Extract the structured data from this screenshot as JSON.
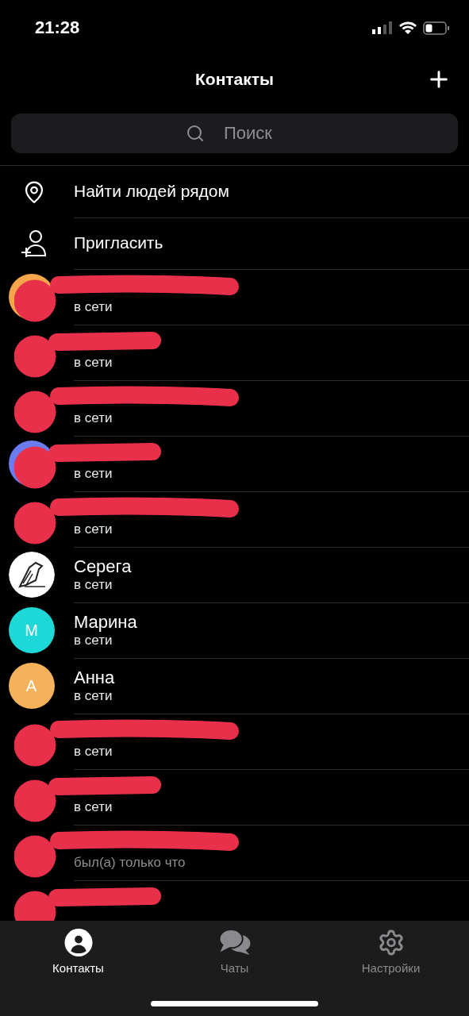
{
  "status_bar": {
    "time": "21:28"
  },
  "header": {
    "title": "Контакты"
  },
  "search": {
    "placeholder": "Поиск"
  },
  "actions": [
    {
      "kind": "nearby",
      "label": "Найти людей рядом"
    },
    {
      "kind": "invite",
      "label": "Пригласить"
    }
  ],
  "contacts": [
    {
      "redacted": true,
      "avatar": {
        "kind": "ring",
        "color": "#f5a54a"
      },
      "status": "в сети",
      "online": true
    },
    {
      "redacted": true,
      "status": "в сети",
      "online": true
    },
    {
      "redacted": true,
      "status": "в сети",
      "online": true
    },
    {
      "redacted": true,
      "avatar": {
        "kind": "ring",
        "color": "#6b7cf0"
      },
      "status": "в сети",
      "online": true
    },
    {
      "redacted": true,
      "status": "в сети",
      "online": true
    },
    {
      "redacted": false,
      "name": "Серега",
      "status": "в сети",
      "online": true
    },
    {
      "redacted": false,
      "name": "Марина",
      "avatar": {
        "kind": "letter",
        "letter": "М",
        "color": "#1ed8d8"
      },
      "status": "в сети",
      "online": true
    },
    {
      "redacted": false,
      "name": "Анна",
      "avatar": {
        "kind": "letter",
        "letter": "А",
        "color": "#f6b25a"
      },
      "status": "в сети",
      "online": true
    },
    {
      "redacted": true,
      "status": "в сети",
      "online": true
    },
    {
      "redacted": true,
      "status": "в сети",
      "online": true
    },
    {
      "redacted": true,
      "status": "был(а) только что",
      "online": false
    },
    {
      "redacted": true
    }
  ],
  "tabs": [
    {
      "kind": "contacts",
      "label": "Контакты",
      "selected": true
    },
    {
      "kind": "chats",
      "label": "Чаты",
      "selected": false
    },
    {
      "kind": "settings",
      "label": "Настройки",
      "selected": false
    }
  ]
}
